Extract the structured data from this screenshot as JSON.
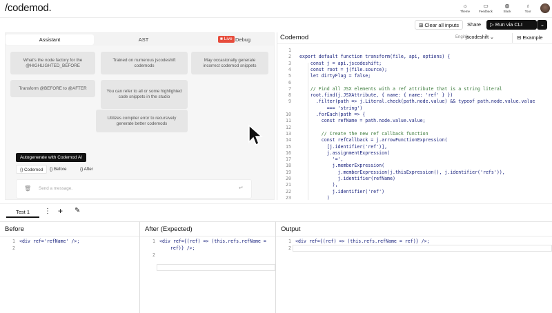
{
  "app": {
    "logo": "/codemod."
  },
  "top_icons": [
    {
      "icon": "sun-icon",
      "label": "Theme",
      "glyph": "☼"
    },
    {
      "icon": "feedback-icon",
      "label": "Feedback",
      "glyph": "▭"
    },
    {
      "icon": "globe-icon",
      "label": "Slack",
      "glyph": "◍"
    },
    {
      "icon": "bulb-icon",
      "label": "Tour",
      "glyph": "♁"
    }
  ],
  "actions": {
    "clear": "Clear all inputs",
    "share": "Share",
    "run": "Run via CLI",
    "run_glyph": "▷",
    "dropdown_glyph": "⌄",
    "clear_glyph": "⊞"
  },
  "left_tabs": {
    "assistant": "Assistant",
    "ast": "AST",
    "live": "Live",
    "debug": "Debug"
  },
  "suggestions": [
    "What's the node factory for the @HIGHLIGHTED_BEFORE",
    "Trained on numerous jscodeshift codemods",
    "May occasionally generate incorrect codemod snippets",
    "Transform @BEFORE to @AFTER",
    "You can refer to all or some highlighted code snippets in the studio",
    "Utilizes compiler error to recursively generate better codemods"
  ],
  "autogen": "Autogenerate with Codemod AI",
  "chips": [
    "{} Codemod",
    "{} Before",
    "{} After"
  ],
  "message": {
    "placeholder": "Send a message.",
    "trash_glyph": "🗑",
    "send_glyph": "↵"
  },
  "codemod": {
    "title": "Codemod",
    "engine_label": "Engine:",
    "engine": "jscodeshift ⌄",
    "example": "Example",
    "example_glyph": "⊟"
  },
  "code_lines": [
    {
      "n": "1",
      "t": ""
    },
    {
      "n": "2",
      "t": "export default function transform(file, api, options) {"
    },
    {
      "n": "3",
      "t": "    const j = api.jscodeshift;"
    },
    {
      "n": "4",
      "t": "    const root = j(file.source);"
    },
    {
      "n": "5",
      "t": "    let dirtyFlag = false;"
    },
    {
      "n": "6",
      "t": ""
    },
    {
      "n": "7",
      "t": "    // Find all JSX elements with a ref attribute that is a string literal"
    },
    {
      "n": "8",
      "t": "    root.find(j.JSXAttribute, { name: { name: 'ref' } })"
    },
    {
      "n": "9",
      "t": "      .filter(path => j.Literal.check(path.node.value) && typeof path.node.value.value"
    },
    {
      "n": "",
      "t": "          === 'string')"
    },
    {
      "n": "10",
      "t": "      .forEach(path => {"
    },
    {
      "n": "11",
      "t": "        const refName = path.node.value.value;"
    },
    {
      "n": "12",
      "t": ""
    },
    {
      "n": "13",
      "t": "        // Create the new ref callback function"
    },
    {
      "n": "14",
      "t": "        const refCallback = j.arrowFunctionExpression("
    },
    {
      "n": "15",
      "t": "          [j.identifier('ref')],"
    },
    {
      "n": "16",
      "t": "          j.assignmentExpression("
    },
    {
      "n": "17",
      "t": "            '=',"
    },
    {
      "n": "18",
      "t": "            j.memberExpression("
    },
    {
      "n": "19",
      "t": "              j.memberExpression(j.thisExpression(), j.identifier('refs')),"
    },
    {
      "n": "20",
      "t": "              j.identifier(refName)"
    },
    {
      "n": "21",
      "t": "            ),"
    },
    {
      "n": "22",
      "t": "            j.identifier('ref')"
    },
    {
      "n": "23",
      "t": "          )"
    }
  ],
  "test": {
    "tab": "Test 1",
    "kebab": "⋮",
    "plus": "+",
    "wand": "✎"
  },
  "panes": {
    "before": {
      "title": "Before",
      "lines": [
        {
          "n": "1",
          "t": "<div ref='refName' />;"
        },
        {
          "n": "2",
          "t": ""
        }
      ]
    },
    "after": {
      "title": "After (Expected)",
      "lines": [
        {
          "n": "1",
          "t": "<div ref={(ref) => (this.refs.refName ="
        },
        {
          "n": "",
          "t": "    ref)} />;"
        },
        {
          "n": "2",
          "t": ""
        }
      ]
    },
    "output": {
      "title": "Output",
      "lines": [
        {
          "n": "1",
          "t": "<div ref={(ref) => (this.refs.refName = ref)} />;"
        },
        {
          "n": "2",
          "t": ""
        }
      ]
    }
  }
}
